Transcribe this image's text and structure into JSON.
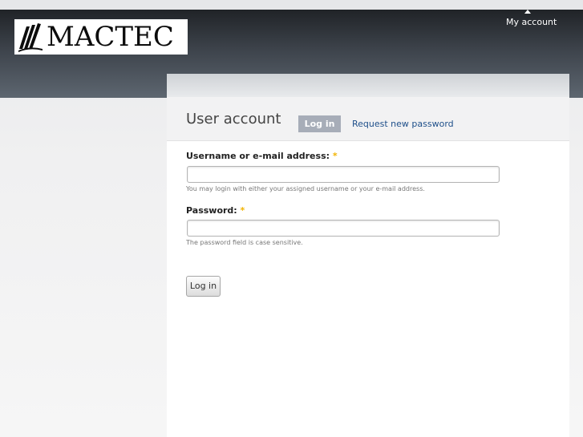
{
  "header": {
    "logo_text": "MACTEC",
    "my_account_label": "My account"
  },
  "page": {
    "title": "User account"
  },
  "tabs": [
    {
      "label": "Log in",
      "active": true
    },
    {
      "label": "Request new password",
      "active": false
    }
  ],
  "form": {
    "username": {
      "label": "Username or e-mail address:",
      "required_mark": "*",
      "value": "",
      "hint": "You may login with either your assigned username or your e-mail address."
    },
    "password": {
      "label": "Password:",
      "required_mark": "*",
      "value": "",
      "hint": "The password field is case sensitive."
    },
    "submit_label": "Log in"
  },
  "colors": {
    "header_dark": "#202327",
    "header_light": "#5d6670",
    "tab_active_bg": "#a7adb8",
    "link": "#1e4f8a",
    "required": "#f2b300"
  },
  "icons": {
    "logo_mark": "book-pages-icon"
  }
}
